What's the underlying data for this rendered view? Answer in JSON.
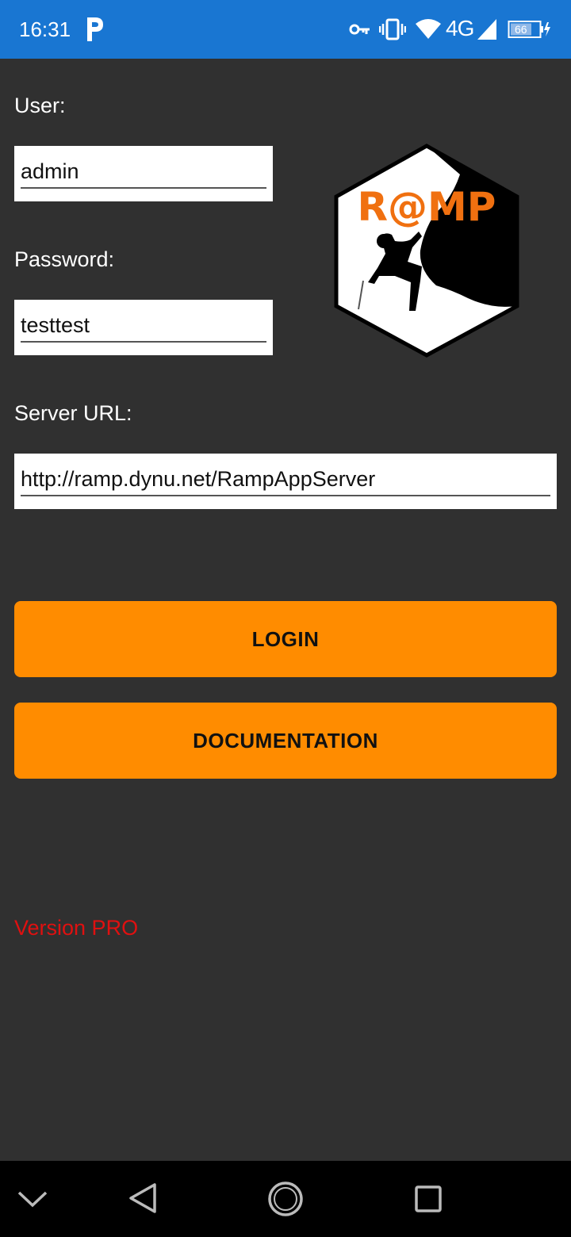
{
  "status_bar": {
    "time": "16:31",
    "network": "4G",
    "battery_level": "66",
    "icons": [
      "parking-app-icon",
      "vpn-key-icon",
      "vibrate-icon",
      "wifi-icon",
      "signal-icon",
      "battery-icon"
    ]
  },
  "login_form": {
    "user_label": "User:",
    "user_value": "admin",
    "password_label": "Password:",
    "password_value": "testtest",
    "server_label": "Server URL:",
    "server_value": "http://ramp.dynu.net/RampAppServer"
  },
  "logo": {
    "text": "R@MP"
  },
  "buttons": {
    "login_label": "LOGIN",
    "documentation_label": "DOCUMENTATION"
  },
  "version_text": "Version PRO",
  "colors": {
    "status_bar": "#1976d2",
    "background": "#303030",
    "button": "#ff8c00",
    "version_text": "#e01010",
    "logo_text": "#f07010"
  },
  "nav_bar": {
    "icons": [
      "chevron-down-icon",
      "back-icon",
      "home-icon",
      "recents-icon"
    ]
  }
}
